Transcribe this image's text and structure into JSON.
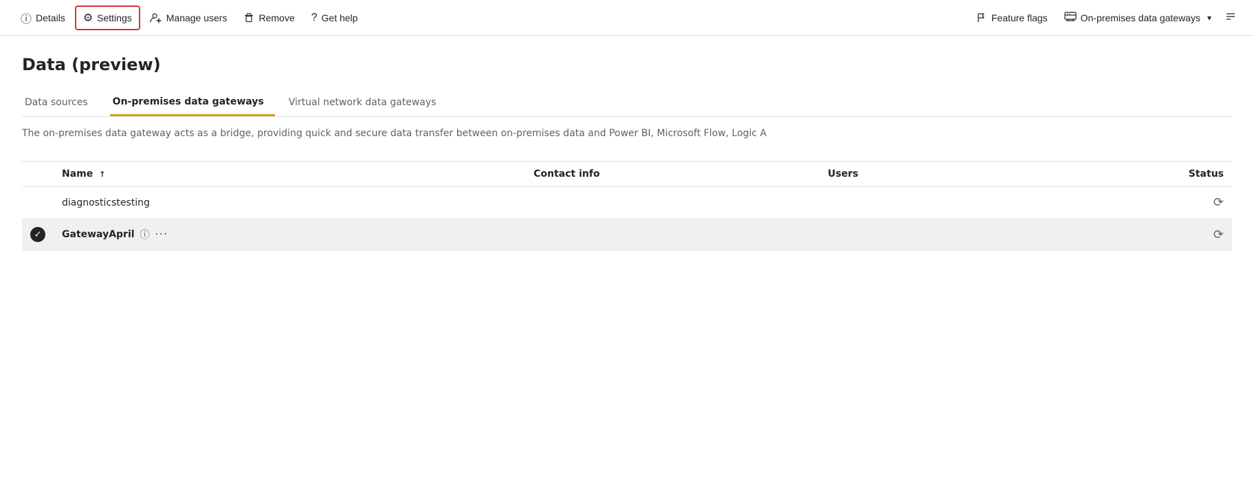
{
  "toolbar": {
    "details_label": "Details",
    "settings_label": "Settings",
    "manage_users_label": "Manage users",
    "remove_label": "Remove",
    "get_help_label": "Get help",
    "feature_flags_label": "Feature flags",
    "on_premises_label": "On-premises data gateways"
  },
  "page": {
    "title": "Data (preview)"
  },
  "tabs": [
    {
      "id": "data-sources",
      "label": "Data sources",
      "active": false
    },
    {
      "id": "on-premises",
      "label": "On-premises data gateways",
      "active": true
    },
    {
      "id": "virtual-network",
      "label": "Virtual network data gateways",
      "active": false
    }
  ],
  "description": "The on-premises data gateway acts as a bridge, providing quick and secure data transfer between on-premises data and Power BI, Microsoft Flow, Logic A",
  "table": {
    "columns": [
      {
        "id": "name",
        "label": "Name",
        "sort": "↑"
      },
      {
        "id": "contact",
        "label": "Contact info"
      },
      {
        "id": "users",
        "label": "Users"
      },
      {
        "id": "status",
        "label": "Status"
      }
    ],
    "rows": [
      {
        "id": "row1",
        "selected": false,
        "check": false,
        "name": "diagnosticstesting",
        "contact": "",
        "users": "",
        "status": "⟳"
      },
      {
        "id": "row2",
        "selected": true,
        "check": true,
        "name": "GatewayApril",
        "contact": "",
        "users": "",
        "status": "⟳"
      }
    ]
  }
}
